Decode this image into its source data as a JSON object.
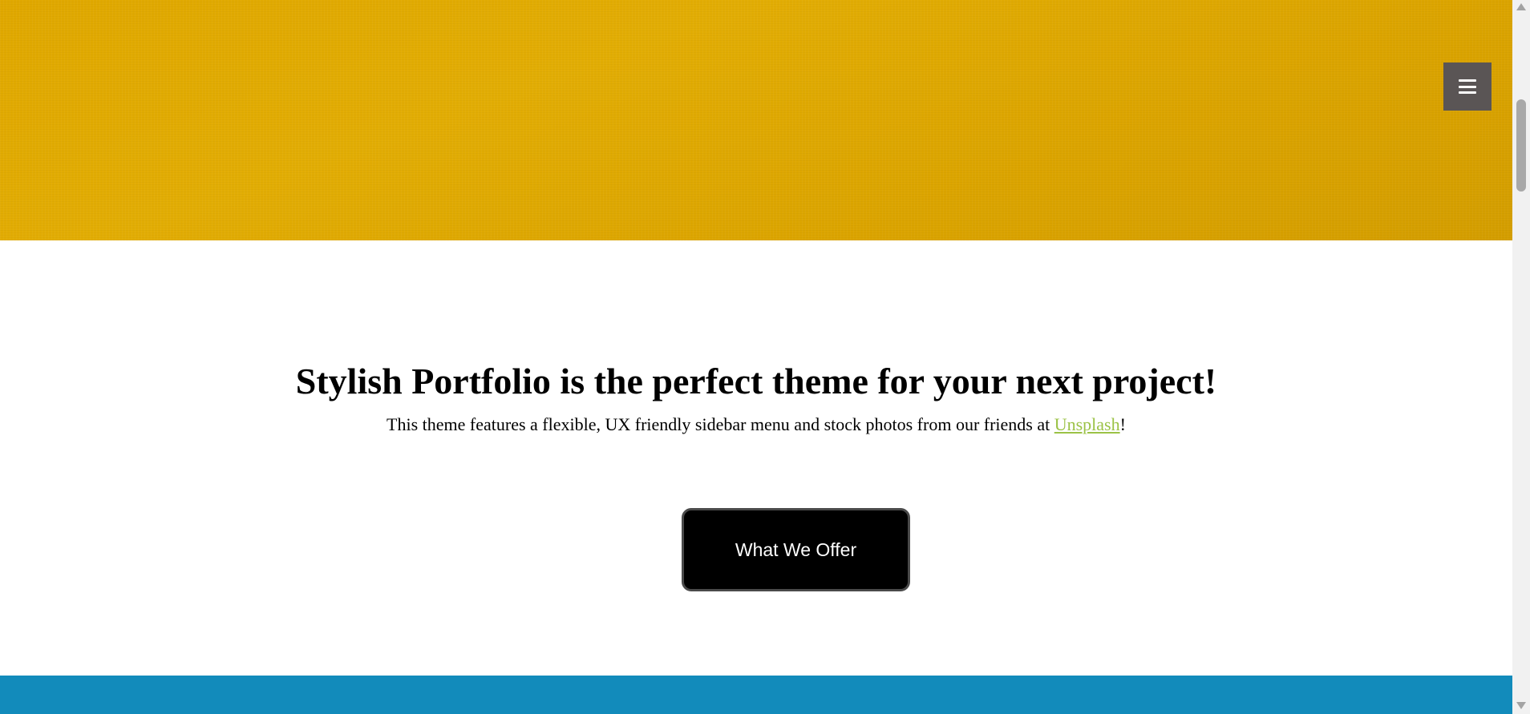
{
  "colors": {
    "hero_background": "#e0a800",
    "menu_button": "#5a5555",
    "link": "#9bc246",
    "button_background": "#000000",
    "services_band": "#128bbb"
  },
  "menu": {
    "icon": "hamburger-menu-icon"
  },
  "about": {
    "heading": "Stylish Portfolio is the perfect theme for your next project!",
    "lead_before": "This theme features a flexible, UX friendly sidebar menu and stock photos from our friends at ",
    "lead_link": "Unsplash",
    "lead_after": "!",
    "button_label": "What We Offer"
  },
  "scrollbar": {
    "up_icon": "scroll-up-arrow-icon",
    "down_icon": "scroll-down-arrow-icon"
  }
}
